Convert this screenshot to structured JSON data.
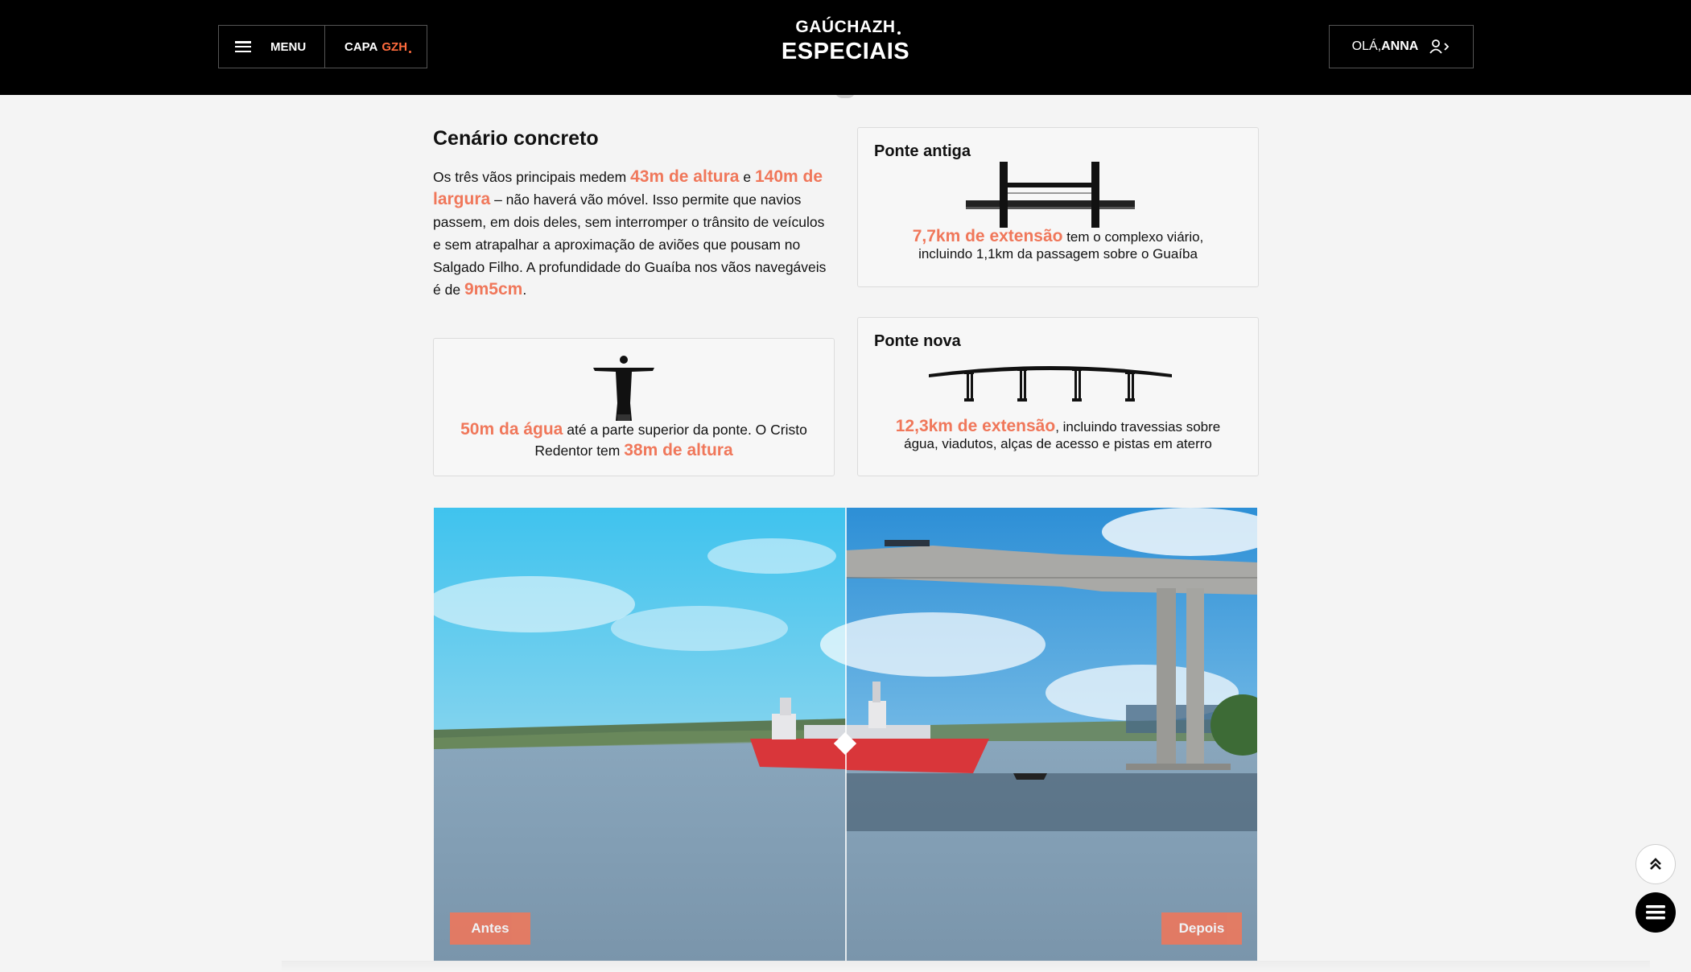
{
  "header": {
    "menu_label": "MENU",
    "capa_label": "CAPA",
    "capa_brand": "GZH",
    "logo_brand": "GAÚCHAZH",
    "logo_section": "ESPECIAIS",
    "greeting": "OLÁ,",
    "user_name": "ANNA"
  },
  "section": {
    "title": "Cenário concreto",
    "intro": {
      "t1": "Os três vãos principais medem ",
      "h1": "43m de altura",
      "t2": " e ",
      "h2": "140m de largura",
      "t3": " – não haverá vão móvel. Isso permite que navios passem, em dois deles, sem interromper o trânsito de veículos e sem atrapalhar a aproximação de aviões que pousam no Salgado Filho. A profundidade do Guaíba nos vãos navegáveis é de ",
      "h3": "9m5cm",
      "t4": "."
    }
  },
  "cards": {
    "old_bridge": {
      "title": "Ponte antiga",
      "highlight": "7,7km de extensão",
      "text1": " tem o complexo viário,",
      "text2": "incluindo 1,1km da passagem sobre o Guaíba",
      "icon": "old-bridge-icon"
    },
    "new_bridge": {
      "title": "Ponte nova",
      "highlight": "12,3km de extensão",
      "text1": ", incluindo travessias sobre",
      "text2": "água, viadutos, alças de acesso e pistas em aterro",
      "icon": "new-bridge-icon"
    },
    "cristo": {
      "highlight1": "50m da água",
      "text1": " até a parte superior da ponte. O Cristo",
      "text2": "Redentor tem ",
      "highlight2": "38m de altura",
      "icon": "cristo-redentor-icon"
    }
  },
  "comparison": {
    "before_label": "Antes",
    "after_label": "Depois"
  },
  "colors": {
    "accent": "#f0775a",
    "header_bg": "#000000",
    "page_bg": "#f4f4f4"
  }
}
